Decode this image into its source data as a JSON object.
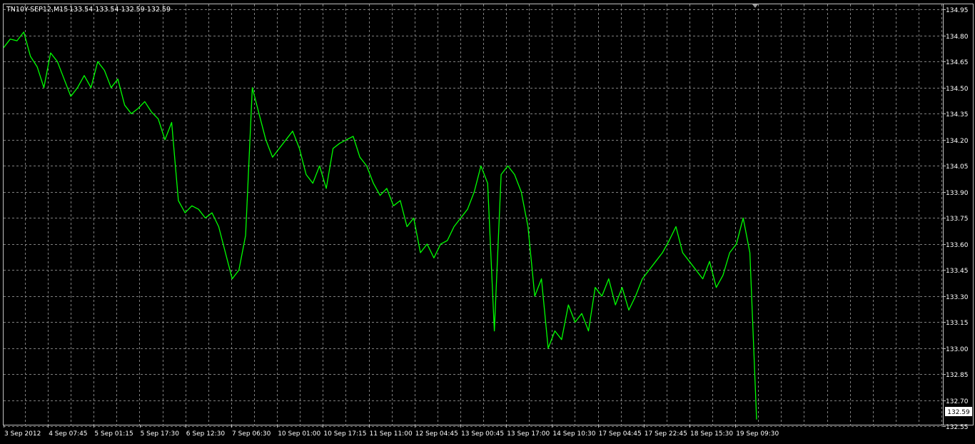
{
  "header": {
    "symbol": "TN10Y-SEP12,M15",
    "ohlc": "133.54 133.54 132.59 132.59"
  },
  "colors": {
    "background": "#000000",
    "grid": "#808080",
    "frame": "#c0c0c0",
    "line": "#00ff00",
    "text": "#ffffff"
  },
  "chart_data": {
    "type": "line",
    "title": "TN10Y-SEP12,M15",
    "xlabel": "",
    "ylabel": "",
    "ylim": [
      132.56,
      134.98
    ],
    "yticks": [
      134.95,
      134.8,
      134.65,
      134.5,
      134.35,
      134.2,
      134.05,
      133.9,
      133.75,
      133.6,
      133.45,
      133.3,
      133.15,
      133.0,
      132.85,
      132.7,
      132.55
    ],
    "xticks": [
      "3 Sep 2012",
      "4 Sep 07:45",
      "5 Sep 01:15",
      "5 Sep 17:30",
      "6 Sep 12:30",
      "7 Sep 06:30",
      "10 Sep 01:00",
      "10 Sep 17:15",
      "11 Sep 11:00",
      "12 Sep 04:45",
      "13 Sep 00:45",
      "13 Sep 17:00",
      "14 Sep 10:30",
      "17 Sep 04:45",
      "17 Sep 22:45",
      "18 Sep 15:30",
      "19 Sep 09:30"
    ],
    "current_price": "132.59",
    "grid": true,
    "series": [
      {
        "values": [
          134.73,
          134.78,
          134.77,
          134.82,
          134.68,
          134.62,
          134.5,
          134.7,
          134.65,
          134.55,
          134.45,
          134.5,
          134.57,
          134.5,
          134.65,
          134.6,
          134.5,
          134.55,
          134.4,
          134.35,
          134.38,
          134.42,
          134.36,
          134.32,
          134.2,
          134.3,
          133.85,
          133.78,
          133.82,
          133.8,
          133.75,
          133.78,
          133.7,
          133.55,
          133.4,
          133.45,
          133.65,
          134.5,
          134.35,
          134.2,
          134.1,
          134.15,
          134.2,
          134.25,
          134.15,
          134.0,
          133.95,
          134.05,
          133.92,
          134.15,
          134.18,
          134.2,
          134.22,
          134.1,
          134.05,
          133.95,
          133.88,
          133.92,
          133.82,
          133.85,
          133.7,
          133.75,
          133.55,
          133.6,
          133.52,
          133.6,
          133.62,
          133.7,
          133.75,
          133.8,
          133.9,
          134.05,
          133.95,
          133.1,
          134.0,
          134.05,
          134.0,
          133.9,
          133.7,
          133.3,
          133.4,
          133.0,
          133.1,
          133.05,
          133.25,
          133.15,
          133.2,
          133.1,
          133.35,
          133.3,
          133.4,
          133.25,
          133.35,
          133.22,
          133.3,
          133.4,
          133.45,
          133.5,
          133.55,
          133.62,
          133.7,
          133.55,
          133.5,
          133.45,
          133.4,
          133.5,
          133.35,
          133.42,
          133.55,
          133.6,
          133.75,
          133.55,
          132.59
        ]
      }
    ]
  }
}
